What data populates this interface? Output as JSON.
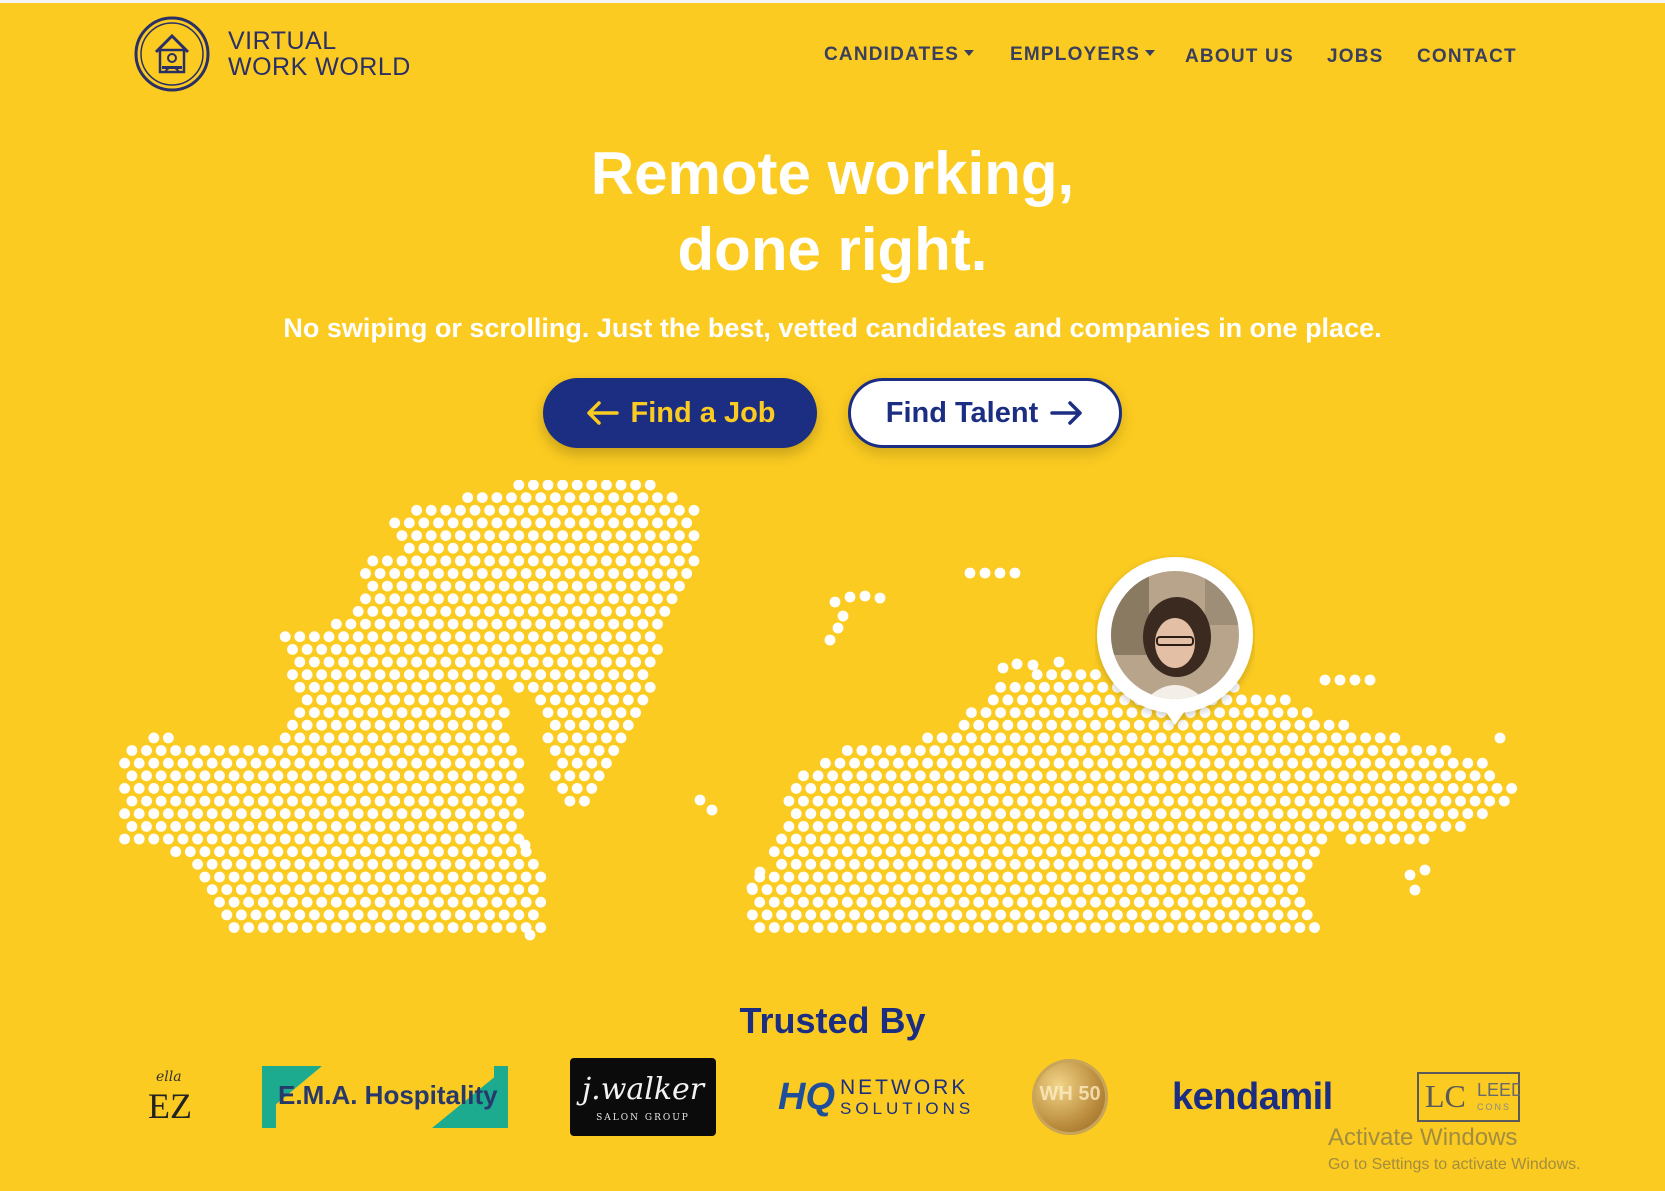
{
  "brand": {
    "line1": "VIRTUAL",
    "line2": "WORK WORLD"
  },
  "nav": {
    "candidates": "CANDIDATES",
    "employers": "EMPLOYERS",
    "about": "ABOUT US",
    "jobs": "JOBS",
    "contact": "CONTACT"
  },
  "hero": {
    "title_line1": "Remote working,",
    "title_line2": "done right.",
    "subtitle": "No swiping or scrolling. Just the best, vetted candidates and companies in one place.",
    "find_job": "Find a Job",
    "find_talent": "Find Talent"
  },
  "trusted": {
    "heading": "Trusted By",
    "logos": [
      {
        "name": "ella-ez",
        "script": "ella",
        "text": "EZ"
      },
      {
        "name": "ema-hospitality",
        "text": "E.M.A. Hospitality"
      },
      {
        "name": "j-walker-salon-group",
        "script": "j.walker",
        "text": "SALON GROUP"
      },
      {
        "name": "hq-network-solutions",
        "mark": "HQ",
        "line1": "NETWORK",
        "line2": "SOLUTIONS"
      },
      {
        "name": "wh-gold-badge",
        "text": "WH 50"
      },
      {
        "name": "kendamil",
        "text": "kendamil"
      },
      {
        "name": "leeds-consulting",
        "mark": "LC",
        "text": "LEED",
        "sub": "CONS"
      }
    ]
  },
  "watermark": {
    "title": "Activate Windows",
    "subtitle": "Go to Settings to activate Windows."
  },
  "colors": {
    "background": "#FBCB21",
    "navy": "#1b2e82",
    "nav_text": "#3a3f5c",
    "white": "#ffffff"
  }
}
